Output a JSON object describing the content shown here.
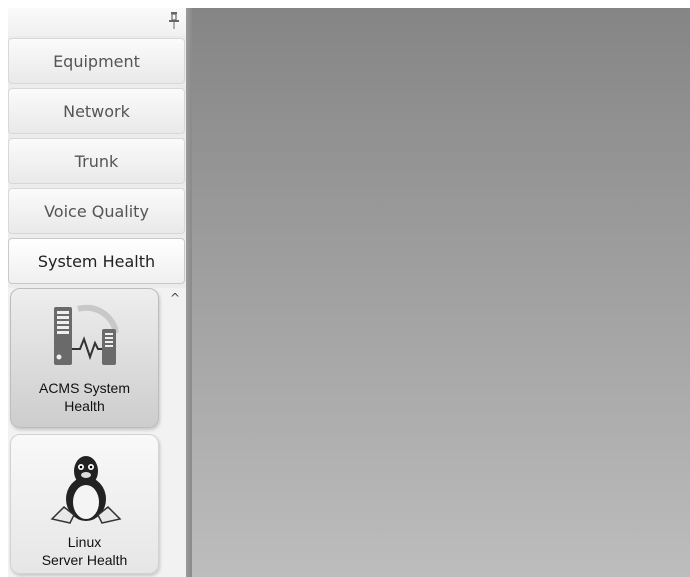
{
  "sidebar": {
    "pin_icon": "pin-icon",
    "nav_items": [
      {
        "label": "Equipment"
      },
      {
        "label": "Network"
      },
      {
        "label": "Trunk"
      },
      {
        "label": "Voice Quality"
      },
      {
        "label": "System Health"
      }
    ],
    "active_item": "System Health",
    "sub_panel": {
      "scroll_icon": "chevron-up-icon",
      "tiles": [
        {
          "line1": "ACMS System",
          "line2": "Health",
          "icon": "server-health-icon"
        },
        {
          "line1": "Linux",
          "line2": "Server Health",
          "icon": "linux-penguin-icon"
        }
      ]
    }
  },
  "colors": {
    "main_top": "#858585",
    "main_bottom": "#bdbdbd",
    "sidebar_bg": "#ececec"
  }
}
